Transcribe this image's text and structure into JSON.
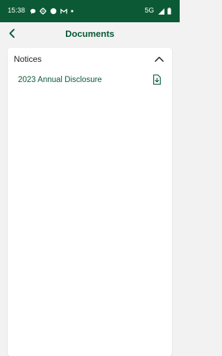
{
  "status_bar": {
    "time": "15:38",
    "network": "5G",
    "background_color": "#0b5a35",
    "icons_left": [
      "chat-bubble-icon",
      "settings-gear-icon",
      "circle-icon",
      "gmail-icon",
      "dot-icon"
    ],
    "icons_right": [
      "signal-icon",
      "battery-icon"
    ]
  },
  "header": {
    "title": "Documents",
    "back_icon": "chevron-left-icon",
    "accent_color": "#0b5a35"
  },
  "section": {
    "title": "Notices",
    "expanded": true,
    "toggle_icon": "chevron-up-icon",
    "documents": [
      {
        "name": "2023 Annual Disclosure",
        "icon": "download-file-icon"
      }
    ]
  }
}
